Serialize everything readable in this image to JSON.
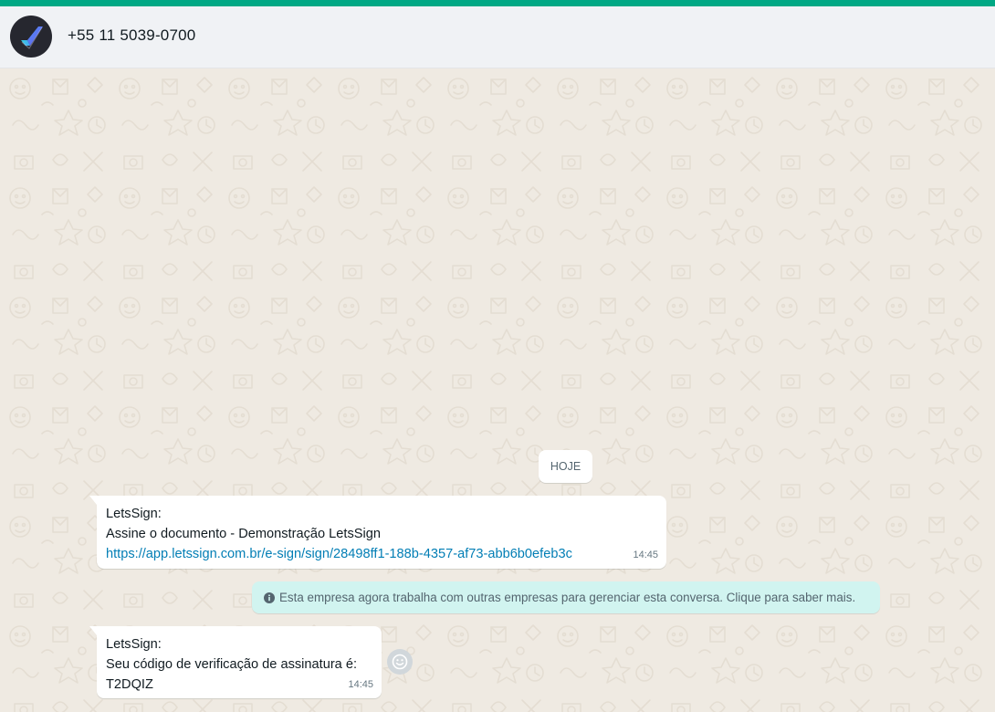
{
  "colors": {
    "accent_strip": "#00a884",
    "header_bg": "#f0f2f5",
    "chat_bg": "#efeae2",
    "bubble_bg": "#ffffff",
    "link": "#027eb5",
    "notice_bg": "#d1f4f0",
    "timestamp": "#667781"
  },
  "header": {
    "avatar_icon": "letssign-logo-icon",
    "title": "+55 11 5039-0700"
  },
  "chat": {
    "date_divider": "HOJE",
    "messages": [
      {
        "sender": "LetsSign:",
        "text": "Assine o documento - Demonstração LetsSign",
        "link": "https://app.letssign.com.br/e-sign/sign/28498ff1-188b-4357-af73-abb6b0efeb3c",
        "time": "14:45"
      },
      {
        "sender": "LetsSign:",
        "text": "Seu código de verificação de assinatura é:",
        "code": "T2DQIZ",
        "time": "14:45"
      }
    ],
    "system_notice": {
      "icon": "info-icon",
      "text": "Esta empresa agora trabalha com outras empresas para gerenciar esta conversa. Clique para saber mais."
    },
    "reaction_icon": "emoji-smiley-icon"
  }
}
